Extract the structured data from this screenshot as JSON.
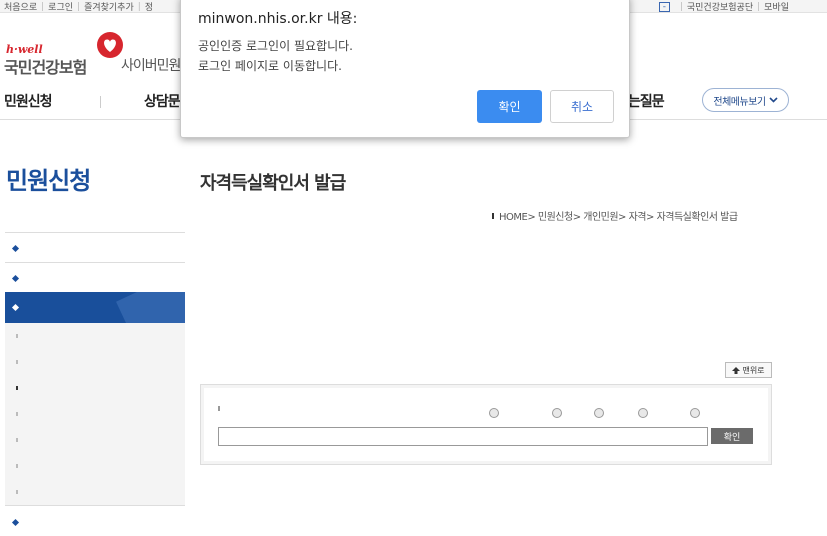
{
  "topbar": {
    "left_links": [
      "처음으로",
      "로그인",
      "즐겨찾기추가",
      "정"
    ],
    "right_links": [
      "국민건강보험공단",
      "모바일"
    ],
    "minus_label": "-"
  },
  "logo": {
    "brand": "h·well",
    "org_name": "국민건강보험",
    "service": "사이버민원"
  },
  "gnb": {
    "items": [
      "민원신청",
      "상담문",
      "는질문"
    ],
    "menu_all_label": "전체메뉴보기"
  },
  "lnb": {
    "title": "민원신청"
  },
  "content": {
    "title": "자격득실확인서 발급",
    "breadcrumb": "HOME> 민원신청> 개인민원> 자격> 자격득실확인서 발급",
    "top_button_label": "맨위로",
    "confirm_button_label": "확인",
    "input_value": ""
  },
  "dialog": {
    "title": "minwon.nhis.or.kr 내용:",
    "message_line1": "공인인증 로그인이 필요합니다.",
    "message_line2": "로그인 페이지로 이동합니다.",
    "ok_label": "확인",
    "cancel_label": "취소"
  },
  "colors": {
    "brand_blue": "#1b4f9c",
    "dialog_ok": "#3b8cf0",
    "brand_red": "#d7262e"
  }
}
